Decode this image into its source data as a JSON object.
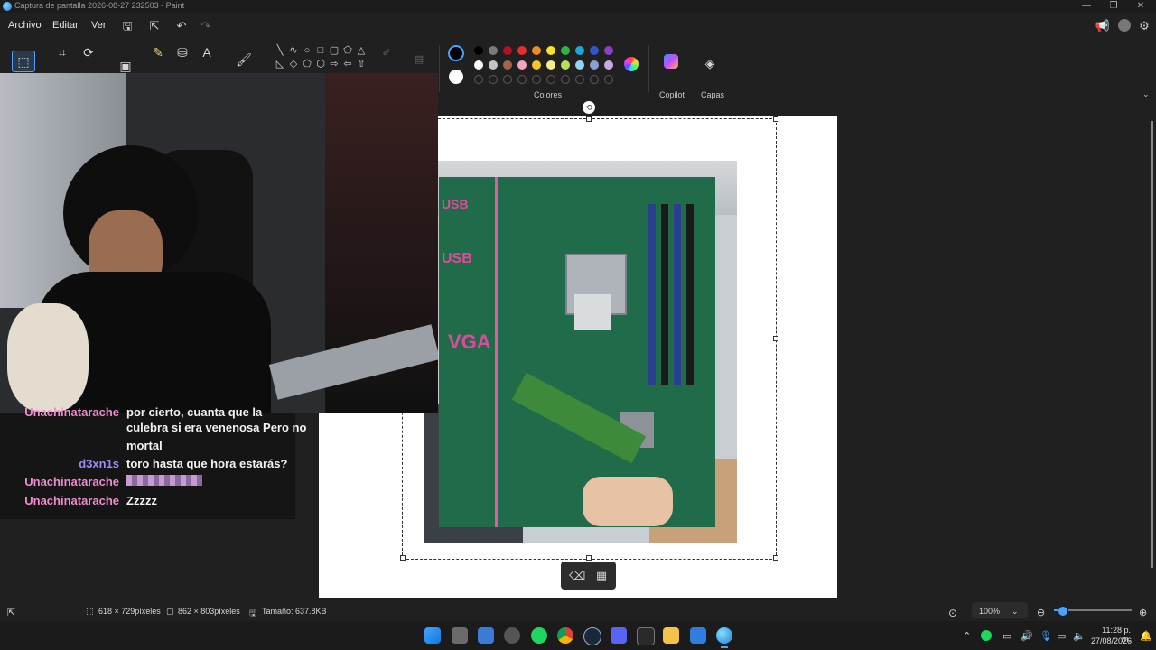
{
  "window": {
    "title": "Captura de pantalla 2026-08-27 232503 - Paint",
    "controls": {
      "minimize": "—",
      "maximize": "❐",
      "close": "✕"
    }
  },
  "menu": {
    "items": [
      "Archivo",
      "Editar",
      "Ver"
    ]
  },
  "ribbon": {
    "colors_label": "Colores",
    "copilot_label": "Copilot",
    "layers_label": "Capas",
    "palette_row1": [
      "#000000",
      "#7a7a7a",
      "#b01020",
      "#e8302a",
      "#f08a24",
      "#f6e12b",
      "#2fb34a",
      "#1fa6d8",
      "#3355cc",
      "#8a40c8"
    ],
    "palette_row2": [
      "#ffffff",
      "#c4c4c4",
      "#a0654a",
      "#f4a4c0",
      "#f6c22e",
      "#f3ee8a",
      "#b6e05a",
      "#8fd4f0",
      "#8aa0d0",
      "#c7a9e3"
    ],
    "active_primary": "#000000",
    "active_secondary": "#ffffff"
  },
  "chat": {
    "messages": [
      {
        "user": "Unachinatarache",
        "text": "por cierto, cuanta que la",
        "user_color": "#f08ad0"
      },
      {
        "user": "",
        "text": "culebra si era venenosa Pero no",
        "user_color": "#f08ad0"
      },
      {
        "user": "",
        "text": "mortal",
        "user_color": "#f08ad0"
      },
      {
        "user": "d3xn1s",
        "text": "toro hasta que hora estarás?",
        "user_color": "#9a8cff"
      },
      {
        "user": "Unachinatarache",
        "text": "",
        "user_color": "#f08ad0"
      },
      {
        "user": "Unachinatarache",
        "text": "Zzzzz",
        "user_color": "#f08ad0"
      }
    ]
  },
  "photo_labels": {
    "usb1": "USB",
    "usb2": "USB",
    "vga": "VGA"
  },
  "status": {
    "selection_size": "618 × 729píxeles",
    "image_size": "862 × 803píxeles",
    "file_size": "Tamaño: 637.8KB",
    "zoom": "100%",
    "zoom_level": 0.1
  },
  "taskbar": {
    "time": "11:28 p. m.",
    "date": "27/08/2026",
    "icons": [
      "windows-start",
      "task-view",
      "app-stream",
      "chrome-alt",
      "spotify",
      "chrome",
      "steam",
      "discord",
      "gta-sa",
      "file-explorer",
      "paint-dot-net",
      "paint"
    ]
  }
}
